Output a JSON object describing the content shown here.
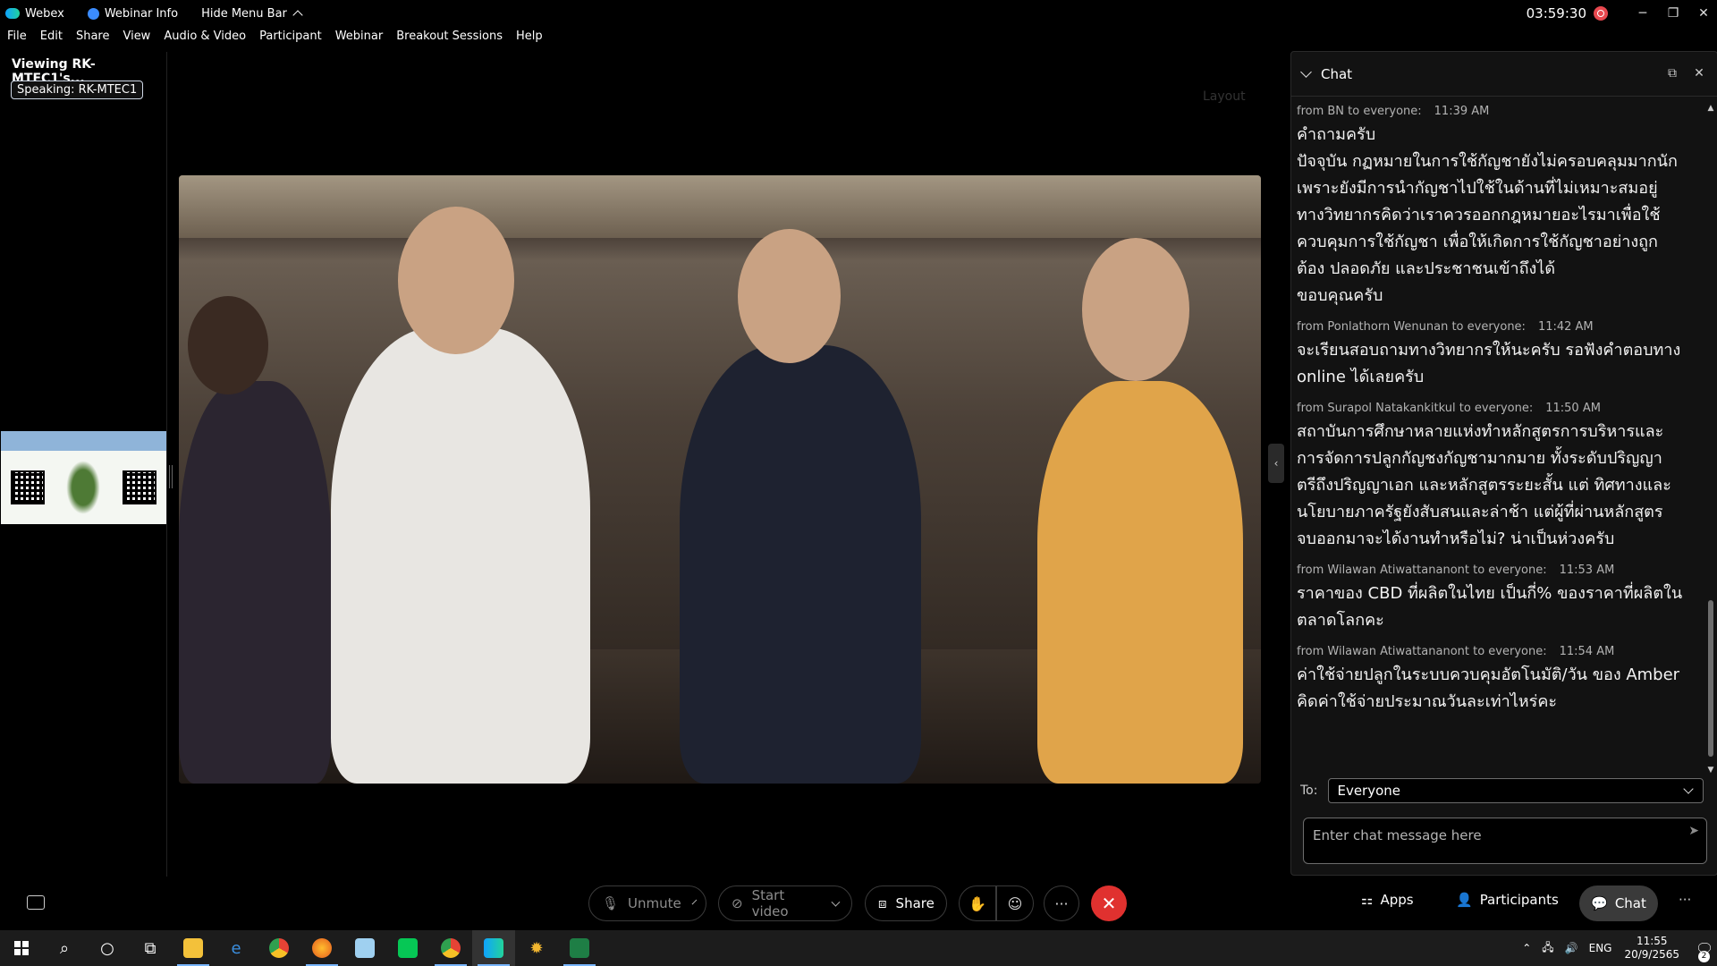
{
  "titlebar": {
    "app_name": "Webex",
    "webinar_info": "Webinar Info",
    "hide_menu_bar": "Hide Menu Bar",
    "timer": "03:59:30"
  },
  "menu": [
    "File",
    "Edit",
    "Share",
    "View",
    "Audio & Video",
    "Participant",
    "Webinar",
    "Breakout Sessions",
    "Help"
  ],
  "left_panel": {
    "viewing": "Viewing RK-MTEC1's...",
    "speaking": "Speaking: RK-MTEC1"
  },
  "video": {
    "layout_label": "Layout"
  },
  "chat": {
    "title": "Chat",
    "messages": [
      {
        "from": "from BN to everyone:",
        "time": "11:39 AM",
        "text": "คำถามครับ\nปัจจุบัน กฏหมายในการใช้กัญชายังไม่ครอบคลุมมากนัก\nเพราะยังมีการนำกัญชาไปใช้ในด้านที่ไม่เหมาะสมอยู่\nทางวิทยากรคิดว่าเราควรออกกฎหมายอะไรมาเพื่อใช้\nควบคุมการใช้กัญชา เพื่อให้เกิดการใช้กัญชาอย่างถูก\nต้อง ปลอดภัย และประชาชนเข้าถึงได้\nขอบคุณครับ"
      },
      {
        "from": "from Ponlathorn Wenunan to everyone:",
        "time": "11:42 AM",
        "text": "จะเรียนสอบถามทางวิทยากรให้นะครับ รอฟังคำตอบทาง\nonline ได้เลยครับ"
      },
      {
        "from": "from Surapol Natakankitkul to everyone:",
        "time": "11:50 AM",
        "text": "สถาบันการศึกษาหลายแห่งทำหลักสูตรการบริหารและ\nการจัดการปลูกกัญชงกัญชามากมาย ทั้งระดับปริญญา\nตรีถึงปริญญาเอก และหลักสูตรระยะสั้น แต่ ทิศทางและ\nนโยบายภาครัฐยังสับสนและล่าช้า แต่ผู้ที่ผ่านหลักสูตร\nจบออกมาจะได้งานทำหรือไม่? น่าเป็นห่วงครับ"
      },
      {
        "from": "from Wilawan Atiwattananont to everyone:",
        "time": "11:53 AM",
        "text": "ราคาของ CBD ที่ผลิตในไทย เป็นกี่% ของราคาที่ผลิตใน\nตลาดโลกคะ"
      },
      {
        "from": "from Wilawan Atiwattananont to everyone:",
        "time": "11:54 AM",
        "text": "ค่าใช้จ่ายปลูกในระบบควบคุมอัตโนมัติ/วัน ของ Amber\nคิดค่าใช้จ่ายประมาณวันละเท่าไหร่คะ"
      }
    ],
    "to_label": "To:",
    "to_value": "Everyone",
    "input_placeholder": "Enter chat message here"
  },
  "controls": {
    "unmute": "Unmute",
    "start_video": "Start video",
    "share": "Share",
    "apps": "Apps",
    "participants": "Participants",
    "chat": "Chat"
  },
  "taskbar": {
    "lang": "ENG",
    "time": "11:55",
    "date": "20/9/2565",
    "notifications": "2"
  },
  "colors": {
    "leave": "#e0312f",
    "recording": "#e8484f",
    "panel_bg": "#121212"
  }
}
